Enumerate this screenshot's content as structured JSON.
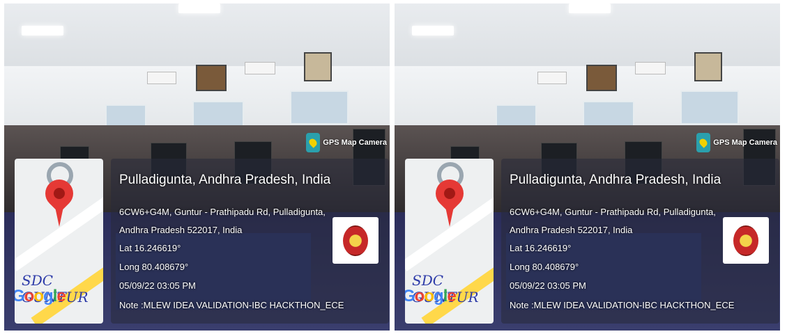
{
  "photo": {
    "app_badge": "GPS Map Camera",
    "place": "Pulladigunta, Andhra Pradesh, India",
    "address_line1": "6CW6+G4M, Guntur - Prathipadu Rd, Pulladigunta,",
    "address_line2": "Andhra Pradesh 522017, India",
    "lat": "Lat 16.246619°",
    "long": "Long 80.408679°",
    "datetime": "05/09/22 03:05 PM",
    "note": "Note :MLEW IDEA VALIDATION-IBC HACKTHON_ECE",
    "map_watermark": "SDC GUNTUR",
    "map_provider": [
      "G",
      "o",
      "o",
      "g",
      "l",
      "e"
    ],
    "icons": [
      "location-pin-icon",
      "gps-map-camera-icon",
      "college-logo"
    ]
  },
  "colors": {
    "pin": "#e53935",
    "overlay": "#282a3a",
    "watermark": "#2c3aa8"
  }
}
